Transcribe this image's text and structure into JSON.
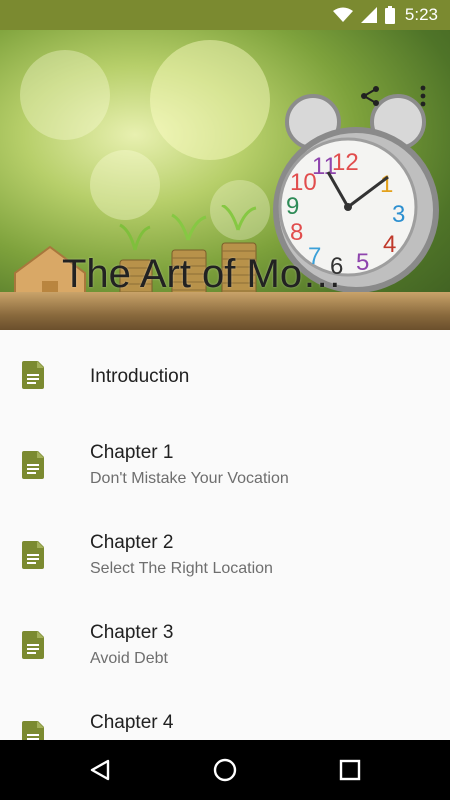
{
  "status_bar": {
    "time": "5:23",
    "icons": [
      "wifi-icon",
      "signal-icon",
      "battery-icon"
    ]
  },
  "header": {
    "title": "The Art of Mo…",
    "actions": [
      "share-icon",
      "more-vert-icon"
    ]
  },
  "chapters": [
    {
      "title": "Introduction",
      "subtitle": ""
    },
    {
      "title": "Chapter 1",
      "subtitle": "Don't Mistake Your Vocation"
    },
    {
      "title": "Chapter 2",
      "subtitle": "Select The Right Location"
    },
    {
      "title": "Chapter 3",
      "subtitle": "Avoid Debt"
    },
    {
      "title": "Chapter 4",
      "subtitle": ""
    }
  ],
  "nav_bar": {
    "buttons": [
      "back-icon",
      "home-icon",
      "recents-icon"
    ]
  },
  "colors": {
    "status_bar": "#7b8a30",
    "doc_icon": "#7b8a30",
    "list_bg": "#fafafa",
    "nav_bar": "#000000"
  }
}
